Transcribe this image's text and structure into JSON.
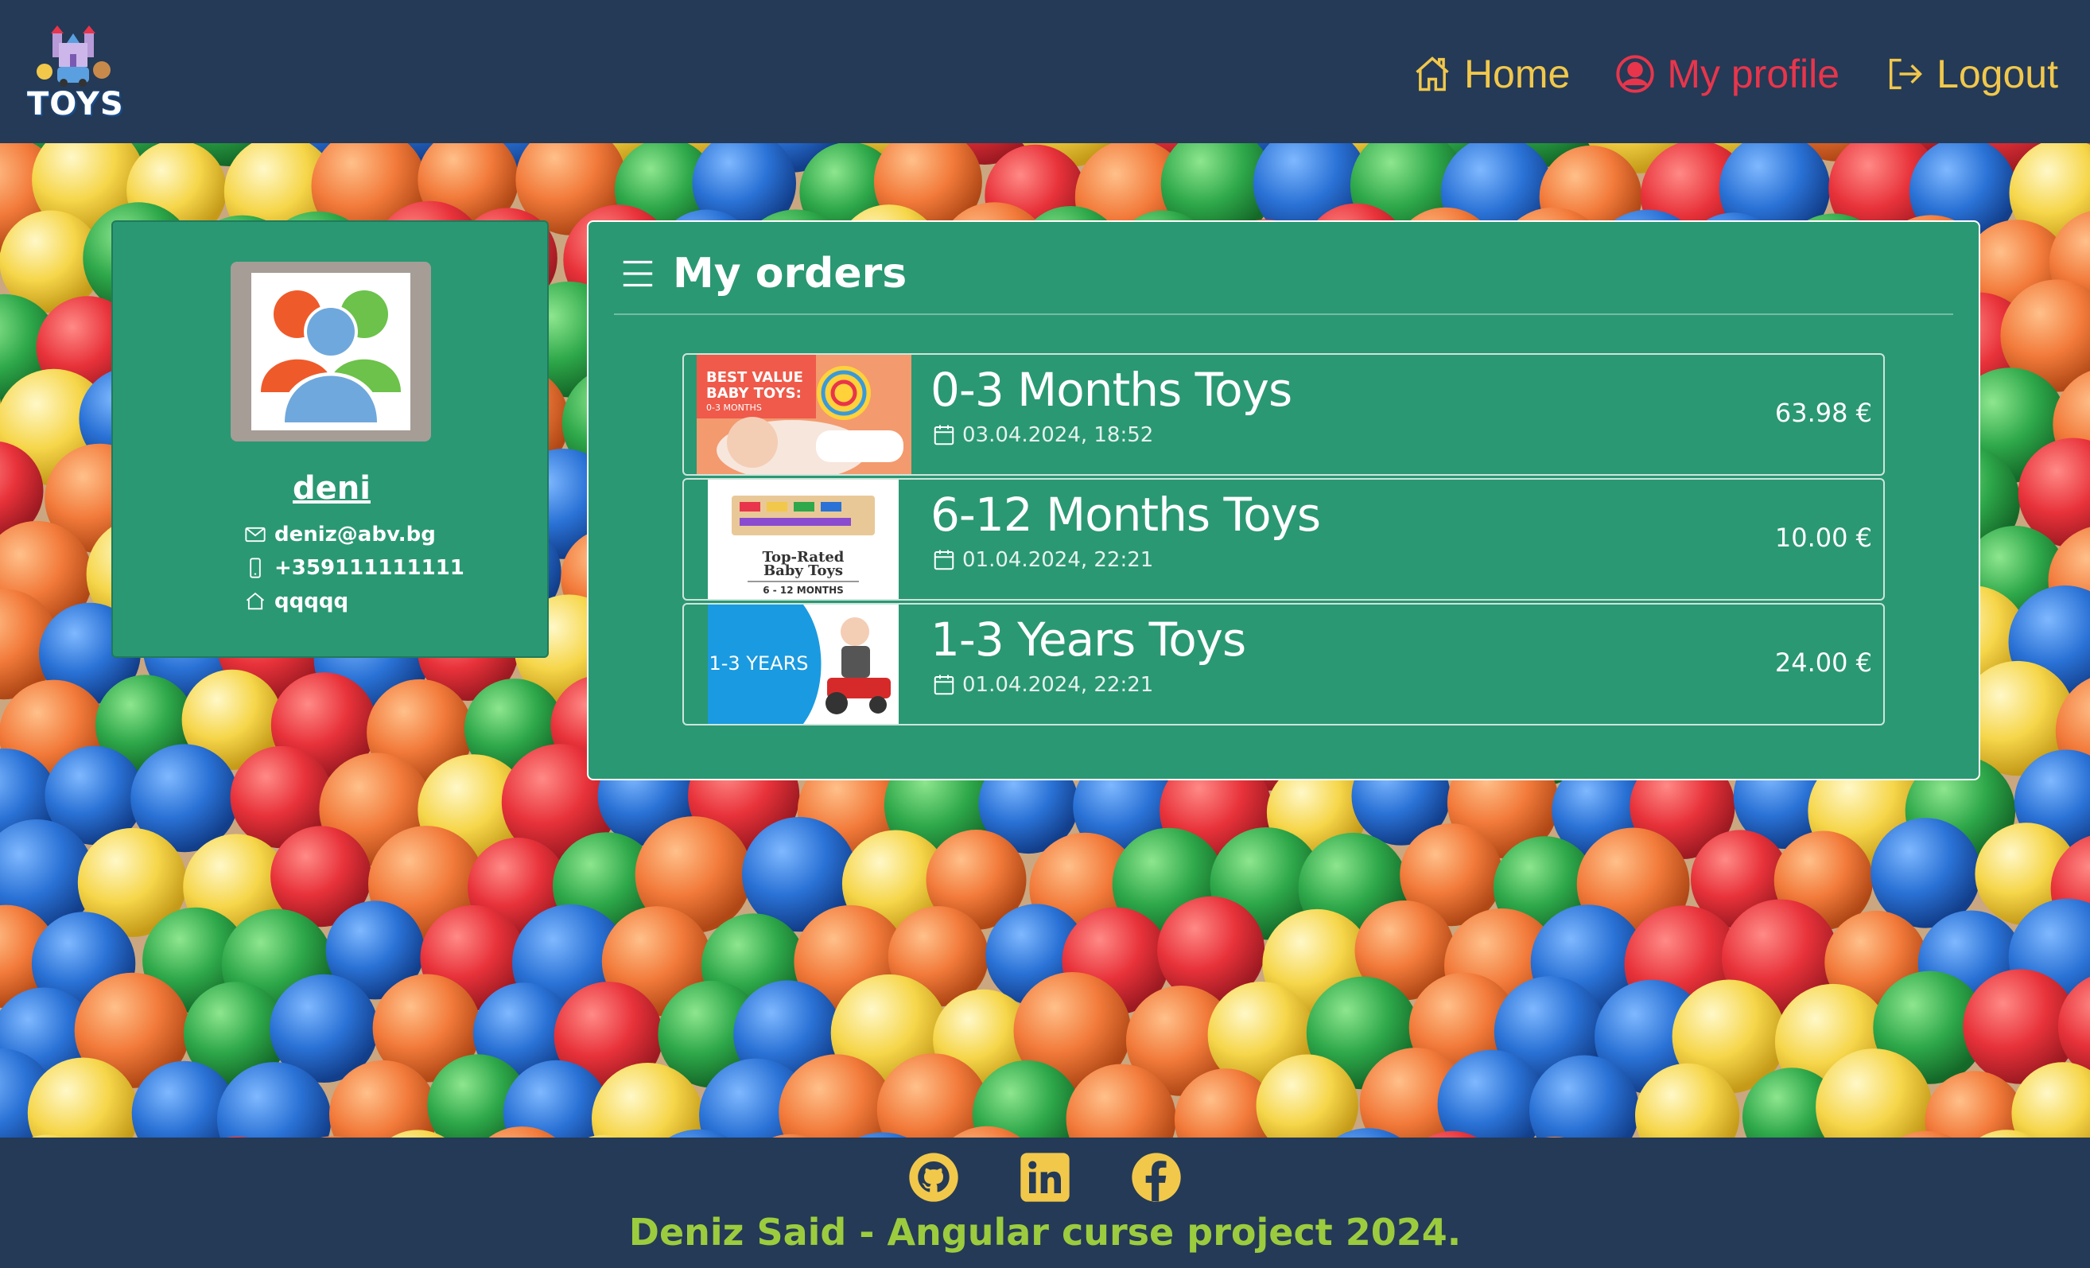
{
  "app": {
    "logo_text": "TOYS"
  },
  "nav": {
    "home": "Home",
    "profile": "My profile",
    "logout": "Logout"
  },
  "colors": {
    "header_bg": "#243a57",
    "nav_text": "#f2c84b",
    "nav_active": "#e8354b",
    "card_green": "#2a9873",
    "footer_text": "#9ccc3e"
  },
  "profile": {
    "username": "deni",
    "email": "deniz@abv.bg",
    "phone": "+359111111111",
    "address": "qqqqq",
    "icons": {
      "email": "envelope-icon",
      "phone": "phone-icon",
      "address": "house-icon"
    }
  },
  "orders": {
    "title": "My orders",
    "items": [
      {
        "name": "0-3 Months Toys",
        "date": "03.04.2024, 18:52",
        "price": "63.98 €",
        "thumb_text": [
          "BEST VALUE",
          "BABY TOYS:",
          "0-3 MONTHS"
        ]
      },
      {
        "name": "6-12 Months Toys",
        "date": "01.04.2024, 22:21",
        "price": "10.00 €",
        "thumb_text": [
          "Top-Rated",
          "Baby Toys",
          "6 - 12 MONTHS"
        ]
      },
      {
        "name": "1-3 Years Toys",
        "date": "01.04.2024, 22:21",
        "price": "24.00 €",
        "thumb_text": [
          "1-3 YEARS"
        ]
      }
    ]
  },
  "footer": {
    "text": "Deniz Said - Angular curse project 2024.",
    "social": [
      "github-icon",
      "linkedin-icon",
      "facebook-icon"
    ]
  }
}
